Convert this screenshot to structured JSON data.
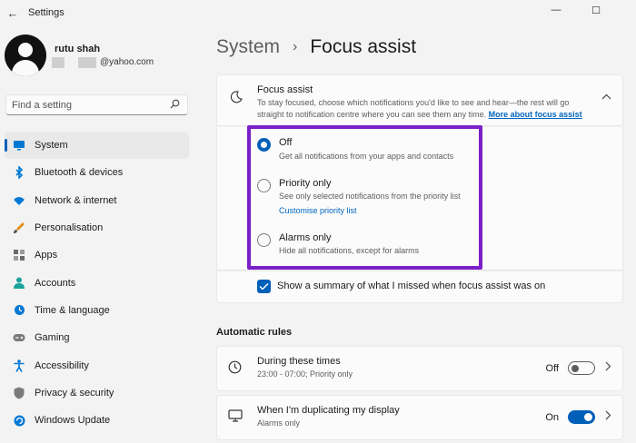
{
  "window": {
    "title": "Settings",
    "back_glyph": "←",
    "minimize_glyph": "—",
    "maximize_glyph": "☐"
  },
  "profile": {
    "name": "rutu shah",
    "email": "@yahoo.com"
  },
  "search": {
    "placeholder": "Find a setting",
    "icon": "search-icon"
  },
  "sidebar": {
    "active": "System",
    "items": [
      {
        "label": "System",
        "icon": "monitor-icon",
        "color": "#0078d4"
      },
      {
        "label": "Bluetooth & devices",
        "icon": "bluetooth-icon",
        "color": "#0078d4"
      },
      {
        "label": "Network & internet",
        "icon": "wifi-icon",
        "color": "#0078d4"
      },
      {
        "label": "Personalisation",
        "icon": "brush-icon",
        "color": "#e38b1f"
      },
      {
        "label": "Apps",
        "icon": "apps-icon",
        "color": "#6b6b6b"
      },
      {
        "label": "Accounts",
        "icon": "person-icon",
        "color": "#1ba39c"
      },
      {
        "label": "Time & language",
        "icon": "globe-clock-icon",
        "color": "#0078d4"
      },
      {
        "label": "Gaming",
        "icon": "gamepad-icon",
        "color": "#6b6b6b"
      },
      {
        "label": "Accessibility",
        "icon": "accessibility-icon",
        "color": "#0078d4"
      },
      {
        "label": "Privacy & security",
        "icon": "shield-icon",
        "color": "#6b6b6b"
      },
      {
        "label": "Windows Update",
        "icon": "update-icon",
        "color": "#0078d4"
      }
    ]
  },
  "breadcrumb": {
    "parent": "System",
    "separator": "›",
    "current": "Focus assist"
  },
  "focus_assist": {
    "title": "Focus assist",
    "description": "To stay focused, choose which notifications you'd like to see and hear—the rest will go straight to notification centre where you can see them any time.",
    "link": "More about focus assist",
    "options": [
      {
        "title": "Off",
        "description": "Get all notifications from your apps and contacts",
        "checked": true
      },
      {
        "title": "Priority only",
        "description": "See only selected notifications from the priority list",
        "link": "Customise priority list",
        "checked": false
      },
      {
        "title": "Alarms only",
        "description": "Hide all notifications, except for alarms",
        "checked": false
      }
    ],
    "summary_label": "Show a summary of what I missed when focus assist was on",
    "summary_checked": true
  },
  "automatic_rules": {
    "title": "Automatic rules",
    "rules": [
      {
        "title": "During these times",
        "subtitle": "23:00 - 07:00; Priority only",
        "state": "Off",
        "on": false,
        "icon": "clock-icon"
      },
      {
        "title": "When I'm duplicating my display",
        "subtitle": "Alarms only",
        "state": "On",
        "on": true,
        "icon": "display-icon"
      }
    ]
  },
  "colors": {
    "accent": "#005fb8",
    "highlight_box": "#7b1fc7",
    "link": "#0067c0"
  }
}
